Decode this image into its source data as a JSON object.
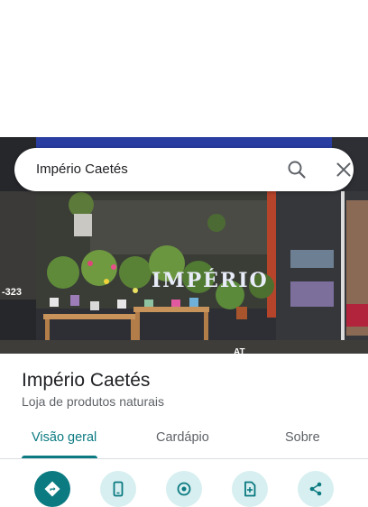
{
  "search": {
    "query": "Império Caetés"
  },
  "photo": {
    "sign_text": "IMPÉRIO",
    "phone_fragment": "-323",
    "sign_fragment": "AT"
  },
  "place": {
    "name": "Império Caetés",
    "category": "Loja de produtos naturais"
  },
  "tabs": [
    {
      "label": "Visão geral",
      "active": true
    },
    {
      "label": "Cardápio",
      "active": false
    },
    {
      "label": "Sobre",
      "active": false
    }
  ],
  "actions": [
    {
      "icon": "directions-icon",
      "primary": true
    },
    {
      "icon": "phone-icon",
      "primary": false
    },
    {
      "icon": "location-icon",
      "primary": false
    },
    {
      "icon": "save-doc-icon",
      "primary": false
    },
    {
      "icon": "share-icon",
      "primary": false
    }
  ],
  "colors": {
    "accent": "#0b7a81",
    "action_bg": "#d7eff0",
    "sign_blue": "#2a3da0"
  }
}
